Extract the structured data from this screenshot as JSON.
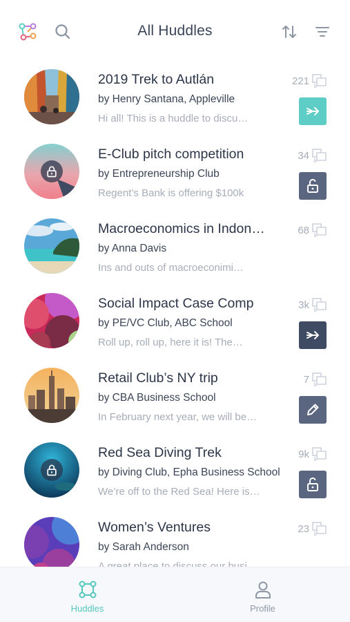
{
  "header": {
    "title": "All Huddles",
    "icons": {
      "logo": "network-logo-icon",
      "search": "search-icon",
      "sort": "sort-icon",
      "filter": "filter-icon"
    }
  },
  "colors": {
    "accent_teal": "#5ecdc5",
    "action_dark": "#5a6680",
    "text_dark": "#2c3548",
    "text_muted": "#a6adb9",
    "tab_active": "#55c7bf",
    "tab_inactive": "#8e97a6"
  },
  "huddles": [
    {
      "title": "2019 Trek to Autlán",
      "subtitle": "by Henry Santana, Appleville",
      "preview": "Hi all! This is a huddle to discu…",
      "count": "221",
      "avatar": "colorful-street-photo",
      "locked": false,
      "action": "join-icon"
    },
    {
      "title": "E-Club pitch competition",
      "subtitle": "by Entrepreneurship Club",
      "preview": "Regent’s Bank is offering $100k",
      "count": "34",
      "avatar": "pink-gradient",
      "locked": true,
      "action": "unlock-icon"
    },
    {
      "title": "Macroeconomics in Indon…",
      "subtitle": "by Anna Davis",
      "preview": "Ins and outs of macroeconimi…",
      "count": "68",
      "avatar": "tropical-beach-photo",
      "locked": false,
      "action": ""
    },
    {
      "title": "Social Impact Case Comp",
      "subtitle": "by PE/VC Club, ABC School",
      "preview": "Roll up, roll up, here it is! The…",
      "count": "3k",
      "avatar": "abstract-magenta-shapes",
      "locked": false,
      "action": "join-icon"
    },
    {
      "title": "Retail Club’s NY trip",
      "subtitle": "by CBA Business School",
      "preview": "In February next year, we will be…",
      "count": "7",
      "avatar": "new-york-skyline-photo",
      "locked": false,
      "action": "edit-icon"
    },
    {
      "title": "Red Sea Diving Trek",
      "subtitle": "by Diving Club, Epha Business School",
      "preview": "We’re off to the Red Sea! Here is…",
      "count": "9k",
      "avatar": "underwater-photo",
      "locked": true,
      "action": "unlock-icon"
    },
    {
      "title": "Women’s Ventures",
      "subtitle": "by Sarah Anderson",
      "preview": "A great place to discuss our busi…",
      "count": "23",
      "avatar": "abstract-purple-shapes",
      "locked": false,
      "action": ""
    }
  ],
  "tabs": [
    {
      "label": "Huddles",
      "icon": "huddles-network-icon",
      "active": true
    },
    {
      "label": "Profile",
      "icon": "person-icon",
      "active": false
    }
  ]
}
